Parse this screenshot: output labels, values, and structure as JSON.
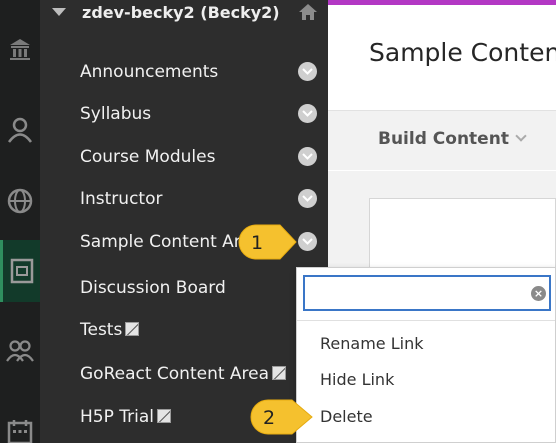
{
  "course": {
    "title": "zdev-becky2 (Becky2)"
  },
  "menu": {
    "items": [
      {
        "label": "Announcements"
      },
      {
        "label": "Syllabus"
      },
      {
        "label": "Course Modules"
      },
      {
        "label": "Instructor"
      },
      {
        "label": "Sample Content Ar"
      },
      {
        "label": "Discussion Board"
      },
      {
        "label": "Tests"
      },
      {
        "label": "GoReact Content Area"
      },
      {
        "label": "H5P Trial"
      }
    ]
  },
  "rail": {
    "icons": [
      "institution-icon",
      "user-icon",
      "globe-icon",
      "courses-icon",
      "groups-icon",
      "calendar-icon"
    ]
  },
  "main": {
    "page_title": "Sample Content",
    "build_content_label": "Build Content"
  },
  "context_menu": {
    "search_value": "",
    "items": [
      "Rename Link",
      "Hide Link",
      "Delete"
    ]
  },
  "callouts": [
    "1",
    "2"
  ],
  "colors": {
    "accent_bar": "#b338c4",
    "callout": "#f5c12e",
    "focus": "#3a76c7",
    "menu_bg": "#2d2d2d"
  }
}
